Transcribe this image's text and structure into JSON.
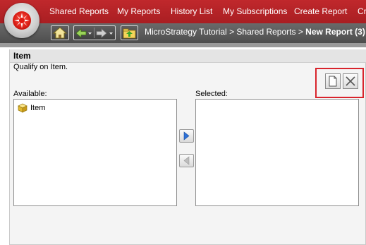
{
  "nav": {
    "items": [
      {
        "label": "Shared Reports"
      },
      {
        "label": "My Reports"
      },
      {
        "label": "History List"
      },
      {
        "label": "My Subscriptions"
      },
      {
        "label": "Create Report"
      },
      {
        "label": "Cr"
      }
    ]
  },
  "toolbar": {
    "home_icon": "home-icon",
    "back_icon": "back-arrow-icon",
    "forward_icon": "forward-arrow-icon",
    "up_icon": "up-folder-icon"
  },
  "breadcrumb": {
    "project": "MicroStrategy Tutorial",
    "sep1": ">",
    "folder": "Shared Reports",
    "sep2": ">",
    "current": "New Report (3)"
  },
  "panel": {
    "title": "Item",
    "subtitle": "Qualify on Item."
  },
  "selector": {
    "available_label": "Available:",
    "selected_label": "Selected:",
    "available_items": [
      {
        "label": "Item",
        "icon": "attribute-cube-icon"
      }
    ],
    "selected_items": []
  },
  "colors": {
    "brand_red": "#c0282c",
    "toolbar_gray": "#555555",
    "highlight_red": "#d8242c"
  }
}
